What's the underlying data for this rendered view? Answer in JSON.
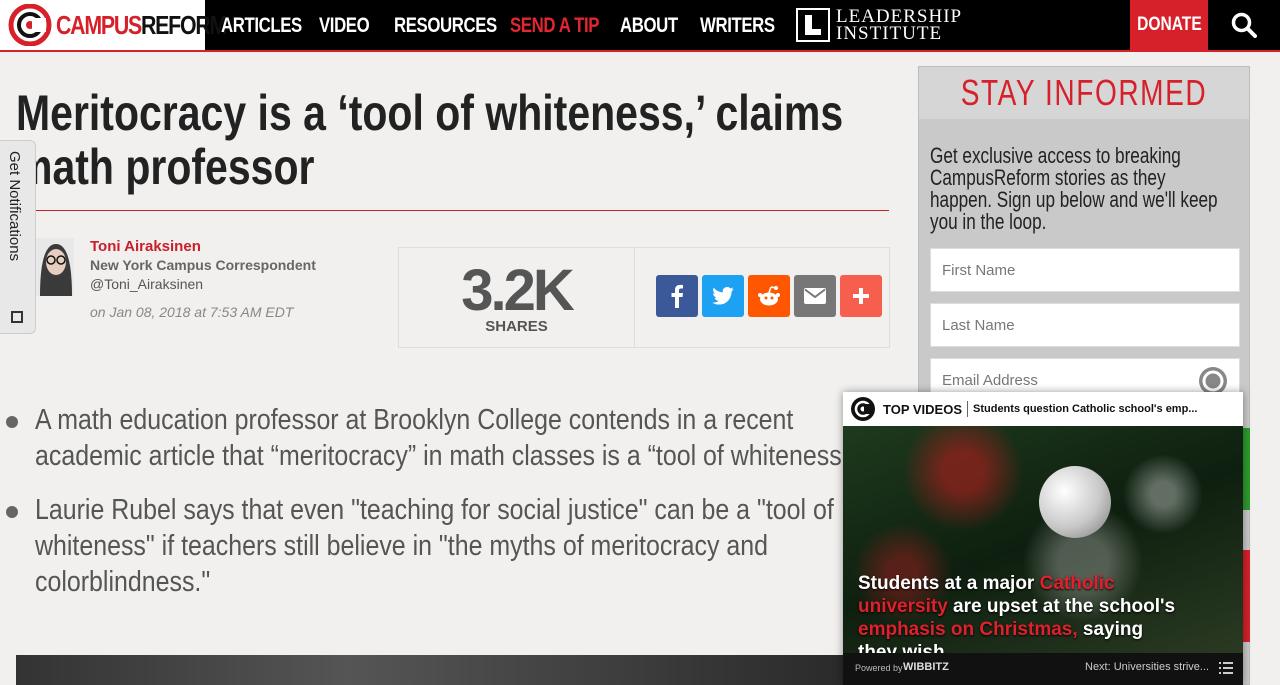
{
  "nav": {
    "logo_red": "CAMPUS",
    "logo_black": "REFORM",
    "links": [
      "ARTICLES",
      "VIDEO",
      "RESOURCES",
      "SEND A TIP",
      "ABOUT",
      "WRITERS"
    ],
    "partner_line1": "LEADERSHIP",
    "partner_line2": "INSTITUTE",
    "donate": "DONATE",
    "search_icon": "search-icon"
  },
  "article": {
    "title": "Meritocracy is a ‘tool of whiteness,’ claims math professor",
    "author_name": "Toni Airaksinen",
    "author_role": "New York Campus Correspondent",
    "author_handle": "@Toni_Airaksinen",
    "date": "on Jan 08, 2018 at 7:53 AM EDT",
    "bullets": [
      "A math education professor at Brooklyn College contends in a recent academic article that “meritocracy” in math classes is a “tool of whiteness.”",
      "Laurie Rubel says that even \"teaching for social justice\" can be a \"tool of whiteness\" if teachers still believe in \"the myths of meritocracy and colorblindness.\""
    ]
  },
  "share": {
    "count": "3.2K",
    "label": "SHARES",
    "buttons": [
      {
        "name": "facebook",
        "glyph": "f",
        "color": "#3b5998"
      },
      {
        "name": "twitter",
        "glyph": "t",
        "color": "#1da1f2"
      },
      {
        "name": "reddit",
        "glyph": "r",
        "color": "#ff5700"
      },
      {
        "name": "email",
        "glyph": "✉",
        "color": "#777777"
      },
      {
        "name": "more",
        "glyph": "+",
        "color": "#f65e4e"
      }
    ]
  },
  "notifications": {
    "label": "Get Notifications"
  },
  "sidebar": {
    "title": "STAY INFORMED",
    "copy": "Get exclusive access to breaking CampusReform stories as they happen. Sign up below and we'll keep you in the loop.",
    "first_name_placeholder": "First Name",
    "last_name_placeholder": "Last Name",
    "email_placeholder": "Email Address"
  },
  "video": {
    "label": "TOP VIDEOS",
    "subtitle": "Students question Catholic school's emp...",
    "caption_parts": [
      {
        "text": "Students at a major ",
        "hl": false
      },
      {
        "text": "Catholic university",
        "hl": true
      },
      {
        "text": " are upset at the school's ",
        "hl": false
      },
      {
        "text": "emphasis on Christmas,",
        "hl": true
      },
      {
        "text": " saying they wish",
        "hl": false
      }
    ],
    "powered": "Powered by",
    "provider": "WIBBITZ",
    "next": "Next: Universities strive..."
  },
  "colors": {
    "brand_red": "#d6202a",
    "nav_bg": "#000000",
    "sidebar_bg": "#c9c9c9"
  }
}
